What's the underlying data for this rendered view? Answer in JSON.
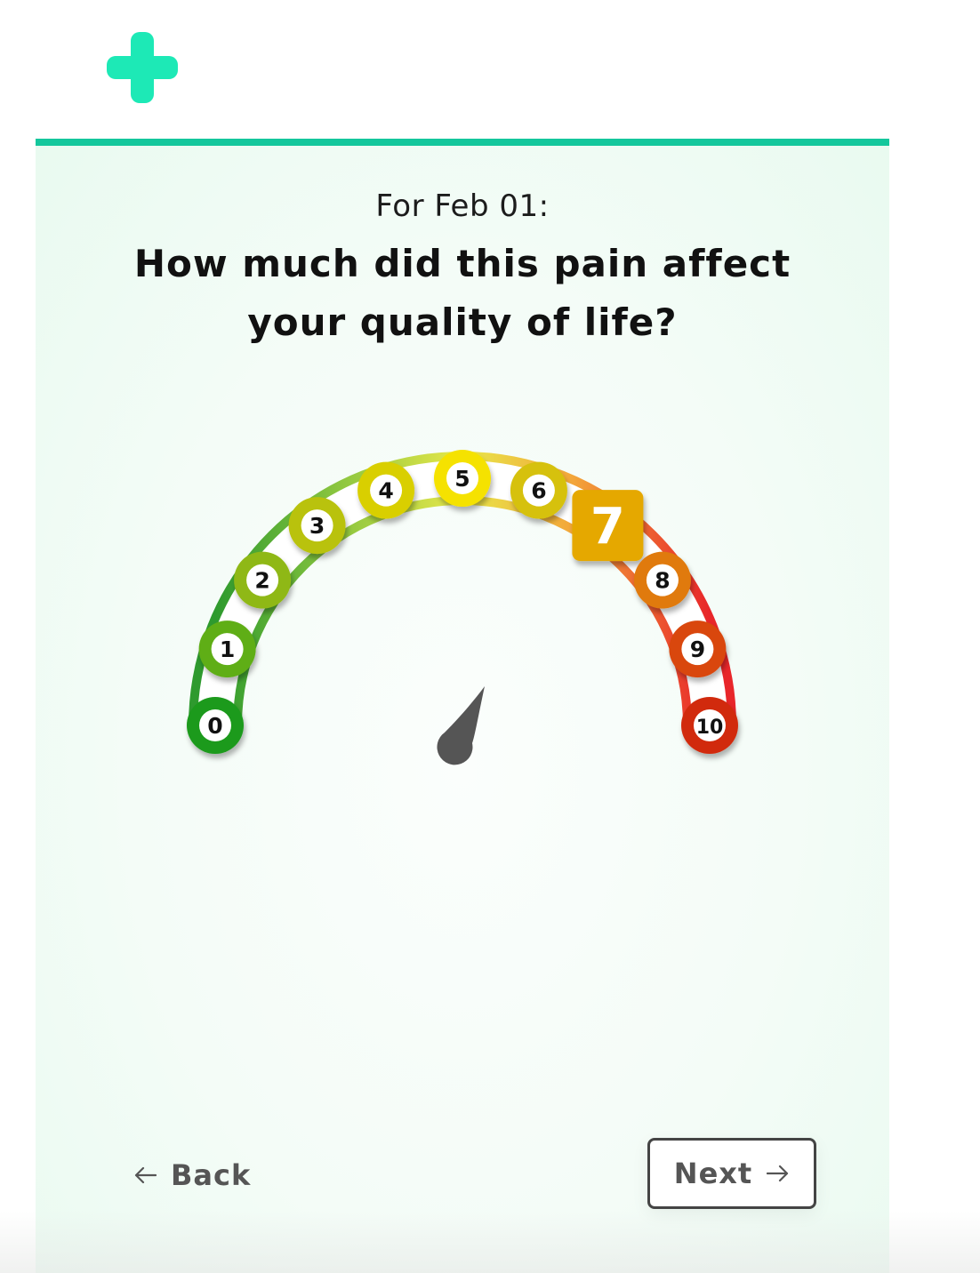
{
  "header": {
    "logo_icon": "plus-cross-icon",
    "logo_color": "#1de9b6",
    "accent_bar_color": "#14c79c"
  },
  "question": {
    "date_label": "For Feb 01:",
    "line1": "How much did this pain affect",
    "line2": "your quality of life?"
  },
  "scale": {
    "options": [
      "0",
      "1",
      "2",
      "3",
      "4",
      "5",
      "6",
      "7",
      "8",
      "9",
      "10"
    ],
    "selected": 7,
    "colors": [
      "#1a9a1a",
      "#5fae18",
      "#8fb812",
      "#b9c20c",
      "#d9cf06",
      "#f5e200",
      "#d6c10a",
      "#e5a800",
      "#e07a0c",
      "#d9470e",
      "#d12c0c"
    ],
    "needle_color": "#555555"
  },
  "navigation": {
    "back_label": "Back",
    "back_icon": "arrow-left-icon",
    "next_label": "Next",
    "next_icon": "arrow-right-icon"
  }
}
